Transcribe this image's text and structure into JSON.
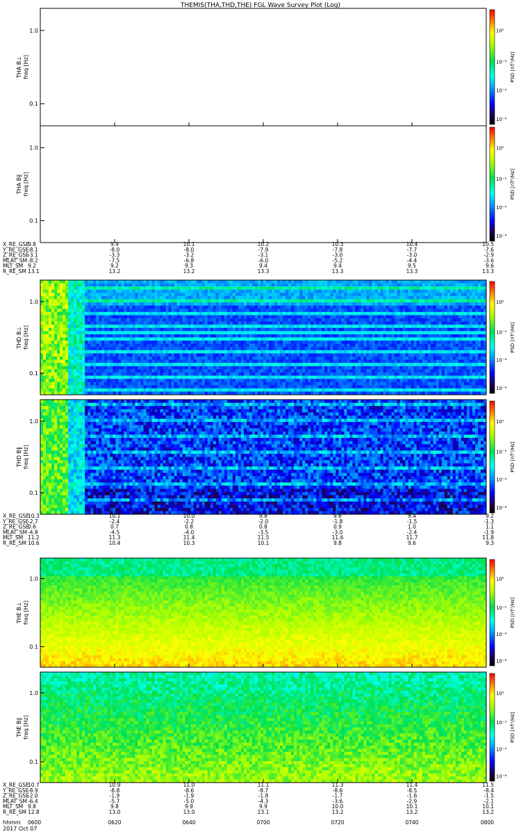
{
  "title": "THEMIS(THA,THD,THE) FGL Wave Survey Plot (Log)",
  "colors": {
    "background": "#ffffff",
    "frame": "#000000"
  },
  "freq_axis": {
    "type": "log",
    "range_hz": [
      0.05,
      2.0
    ],
    "ticks": [
      "1.0",
      "0.1"
    ]
  },
  "colorbar_label": "PSD [nT²/Hz]",
  "colorbar_ticks": [
    "10⁰",
    "10⁻²",
    "10⁻⁴",
    "10⁻⁶"
  ],
  "time_axis": {
    "label": "hhmm",
    "date": "2017 Oct 07",
    "ticks": [
      "0600",
      "0620",
      "0640",
      "0700",
      "0720",
      "0740",
      "0800"
    ]
  },
  "panels": [
    {
      "id": "tha_bl",
      "label": "THA B⊥",
      "ylabel": "freq [Hz]",
      "palette": "none",
      "empty": true
    },
    {
      "id": "tha_bpar",
      "label": "THA B∥",
      "ylabel": "freq [Hz]",
      "palette": "none",
      "empty": true
    },
    {
      "id": "thd_bl",
      "label": "THD B⊥",
      "ylabel": "freq [Hz]",
      "palette": "thd",
      "empty": false
    },
    {
      "id": "thd_bpar",
      "label": "THD B∥",
      "ylabel": "freq [Hz]",
      "palette": "thd2",
      "empty": false
    },
    {
      "id": "the_bl",
      "label": "THE B⊥",
      "ylabel": "freq [Hz]",
      "palette": "the",
      "empty": false
    },
    {
      "id": "the_bpar",
      "label": "THE B∥",
      "ylabel": "freq [Hz]",
      "palette": "the2",
      "empty": false
    }
  ],
  "ephemeris": [
    {
      "probe": "THA",
      "rows": [
        {
          "name": "X_RE_GSE",
          "values": [
            "9.8",
            "9.9",
            "10.1",
            "10.2",
            "10.3",
            "10.4",
            "10.5"
          ]
        },
        {
          "name": "Y_RE_GSE",
          "values": [
            "-8.1",
            "-8.0",
            "-8.0",
            "-7.9",
            "-7.8",
            "-7.7",
            "-7.6"
          ]
        },
        {
          "name": "Z_RE_GSE",
          "values": [
            "-3.1",
            "-3.3",
            "-3.2",
            "-3.1",
            "-3.0",
            "-3.0",
            "-2.9"
          ]
        },
        {
          "name": "MLAT_SM",
          "values": [
            "-8.2",
            "-7.5",
            "-6.8",
            "-6.0",
            "-5.2",
            "-4.4",
            "-3.6"
          ]
        },
        {
          "name": "MLT_SM",
          "values": [
            "9.2",
            "9.2",
            "9.3",
            "9.4",
            "9.4",
            "9.5",
            "9.6"
          ]
        },
        {
          "name": "R_RE_SM",
          "values": [
            "13.1",
            "13.2",
            "13.2",
            "13.3",
            "13.3",
            "13.3",
            "13.3"
          ]
        }
      ]
    },
    {
      "probe": "THD",
      "rows": [
        {
          "name": "X_RE_GSE",
          "values": [
            "10.3",
            "10.1",
            "10.0",
            "9.8",
            "9.6",
            "9.4",
            "9.2"
          ]
        },
        {
          "name": "Y_RE_GSE",
          "values": [
            "-2.7",
            "-2.4",
            "-2.2",
            "-2.0",
            "-1.8",
            "-1.5",
            "-1.3"
          ]
        },
        {
          "name": "Z_RE_GSE",
          "values": [
            "0.6",
            "0.7",
            "0.8",
            "0.8",
            "0.9",
            "1.0",
            "1.1"
          ]
        },
        {
          "name": "MLAT_SM",
          "values": [
            "-4.8",
            "-4.5",
            "-4.0",
            "-3.5",
            "-3.0",
            "-2.4",
            "-1.9"
          ]
        },
        {
          "name": "MLT_SM",
          "values": [
            "11.2",
            "11.3",
            "11.4",
            "11.5",
            "11.6",
            "11.7",
            "11.8"
          ]
        },
        {
          "name": "R_RE_SM",
          "values": [
            "10.6",
            "10.4",
            "10.3",
            "10.1",
            "9.8",
            "9.6",
            "9.3"
          ]
        }
      ]
    },
    {
      "probe": "THE",
      "rows": [
        {
          "name": "X_RE_GSE",
          "values": [
            "10.7",
            "10.9",
            "11.0",
            "11.1",
            "11.3",
            "11.4",
            "11.5"
          ]
        },
        {
          "name": "Y_RE_GSE",
          "values": [
            "-8.9",
            "-8.8",
            "-8.6",
            "-8.7",
            "-8.6",
            "-8.5",
            "-8.4"
          ]
        },
        {
          "name": "Z_RE_GSE",
          "values": [
            "-2.0",
            "-1.9",
            "-1.9",
            "-1.8",
            "-1.7",
            "-1.6",
            "-1.5"
          ]
        },
        {
          "name": "MLAT_SM",
          "values": [
            "-6.4",
            "-5.7",
            "-5.0",
            "-4.3",
            "-3.6",
            "-2.9",
            "-2.1"
          ]
        },
        {
          "name": "MLT_SM",
          "values": [
            "9.8",
            "9.8",
            "9.9",
            "9.9",
            "10.0",
            "10.1",
            "10.1"
          ]
        },
        {
          "name": "R_RE_SM",
          "values": [
            "12.8",
            "13.0",
            "13.0",
            "13.1",
            "13.2",
            "13.2",
            "13.2"
          ]
        }
      ]
    }
  ],
  "chart_data": {
    "type": "heatmap",
    "title": "THEMIS(THA,THD,THE) FGL Wave Survey Plot (Log)",
    "x_ticks": [
      "0600",
      "0620",
      "0640",
      "0700",
      "0720",
      "0740",
      "0800"
    ],
    "y_scale": "log",
    "y_range": [
      0.05,
      2.0
    ],
    "y_ticks": [
      1.0,
      0.1
    ],
    "z_scale": "log",
    "z_range": [
      1e-06,
      10
    ],
    "z_ticks": [
      "10⁰",
      "10⁻²",
      "10⁻⁴",
      "10⁻⁶"
    ],
    "series": [
      {
        "name": "THA B⊥",
        "values": []
      },
      {
        "name": "THA B∥",
        "values": []
      },
      {
        "name": "THD B⊥",
        "values": []
      },
      {
        "name": "THD B∥",
        "values": []
      },
      {
        "name": "THE B⊥",
        "values": []
      },
      {
        "name": "THE B∥",
        "values": []
      }
    ]
  }
}
